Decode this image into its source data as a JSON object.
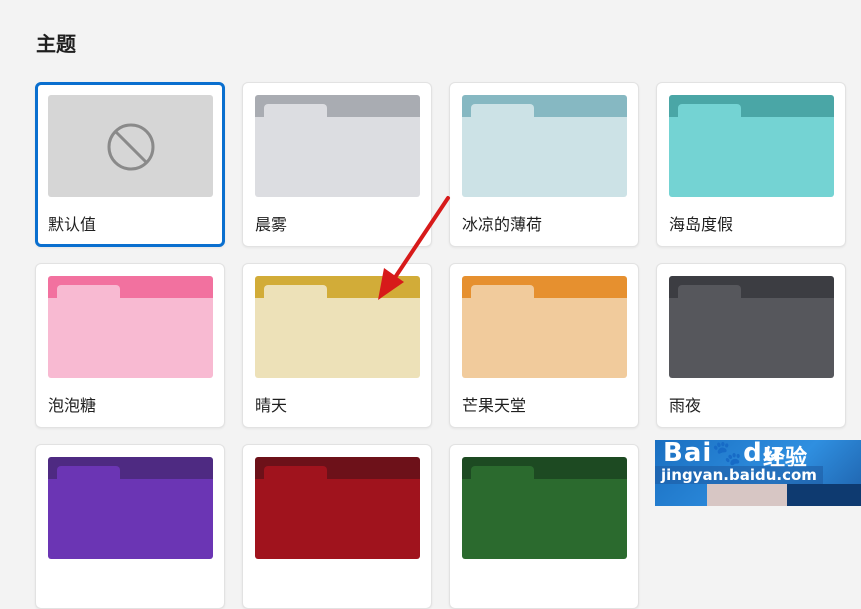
{
  "section": {
    "title": "主题"
  },
  "themes": [
    {
      "name": "默认值",
      "selected": true,
      "type": "none",
      "icon": "no-symbol-icon"
    },
    {
      "name": "晨雾",
      "band": "#a9acb2",
      "tab": "#dcdde1",
      "body": "#dcdde1"
    },
    {
      "name": "冰凉的薄荷",
      "band": "#86b8c2",
      "tab": "#cce2e6",
      "body": "#cce2e6"
    },
    {
      "name": "海岛度假",
      "band": "#4aa6a6",
      "tab": "#74d3d3",
      "body": "#74d3d3"
    },
    {
      "name": "泡泡糖",
      "band": "#f2719f",
      "tab": "#f8bad2",
      "body": "#f8bad2"
    },
    {
      "name": "晴天",
      "band": "#d2ac38",
      "tab": "#ede1b8",
      "body": "#ede1b8"
    },
    {
      "name": "芒果天堂",
      "band": "#e6902f",
      "tab": "#f1cb9c",
      "body": "#f1cb9c"
    },
    {
      "name": "雨夜",
      "band": "#3c3d42",
      "tab": "#56575c",
      "body": "#56575c"
    },
    {
      "name": "",
      "band": "#4e2a82",
      "tab": "#6b35b4",
      "body": "#6b35b4"
    },
    {
      "name": "",
      "band": "#6d1119",
      "tab": "#a0131d",
      "body": "#a0131d"
    },
    {
      "name": "",
      "band": "#1d4a22",
      "tab": "#2b6a2e",
      "body": "#2b6a2e"
    }
  ],
  "watermark": {
    "logo": "Bai",
    "logo_tail": "du",
    "name": "经验",
    "url": "jingyan.baidu.com"
  },
  "colors": {
    "accent": "#0a6fcf",
    "arrow": "#d71a1a"
  }
}
